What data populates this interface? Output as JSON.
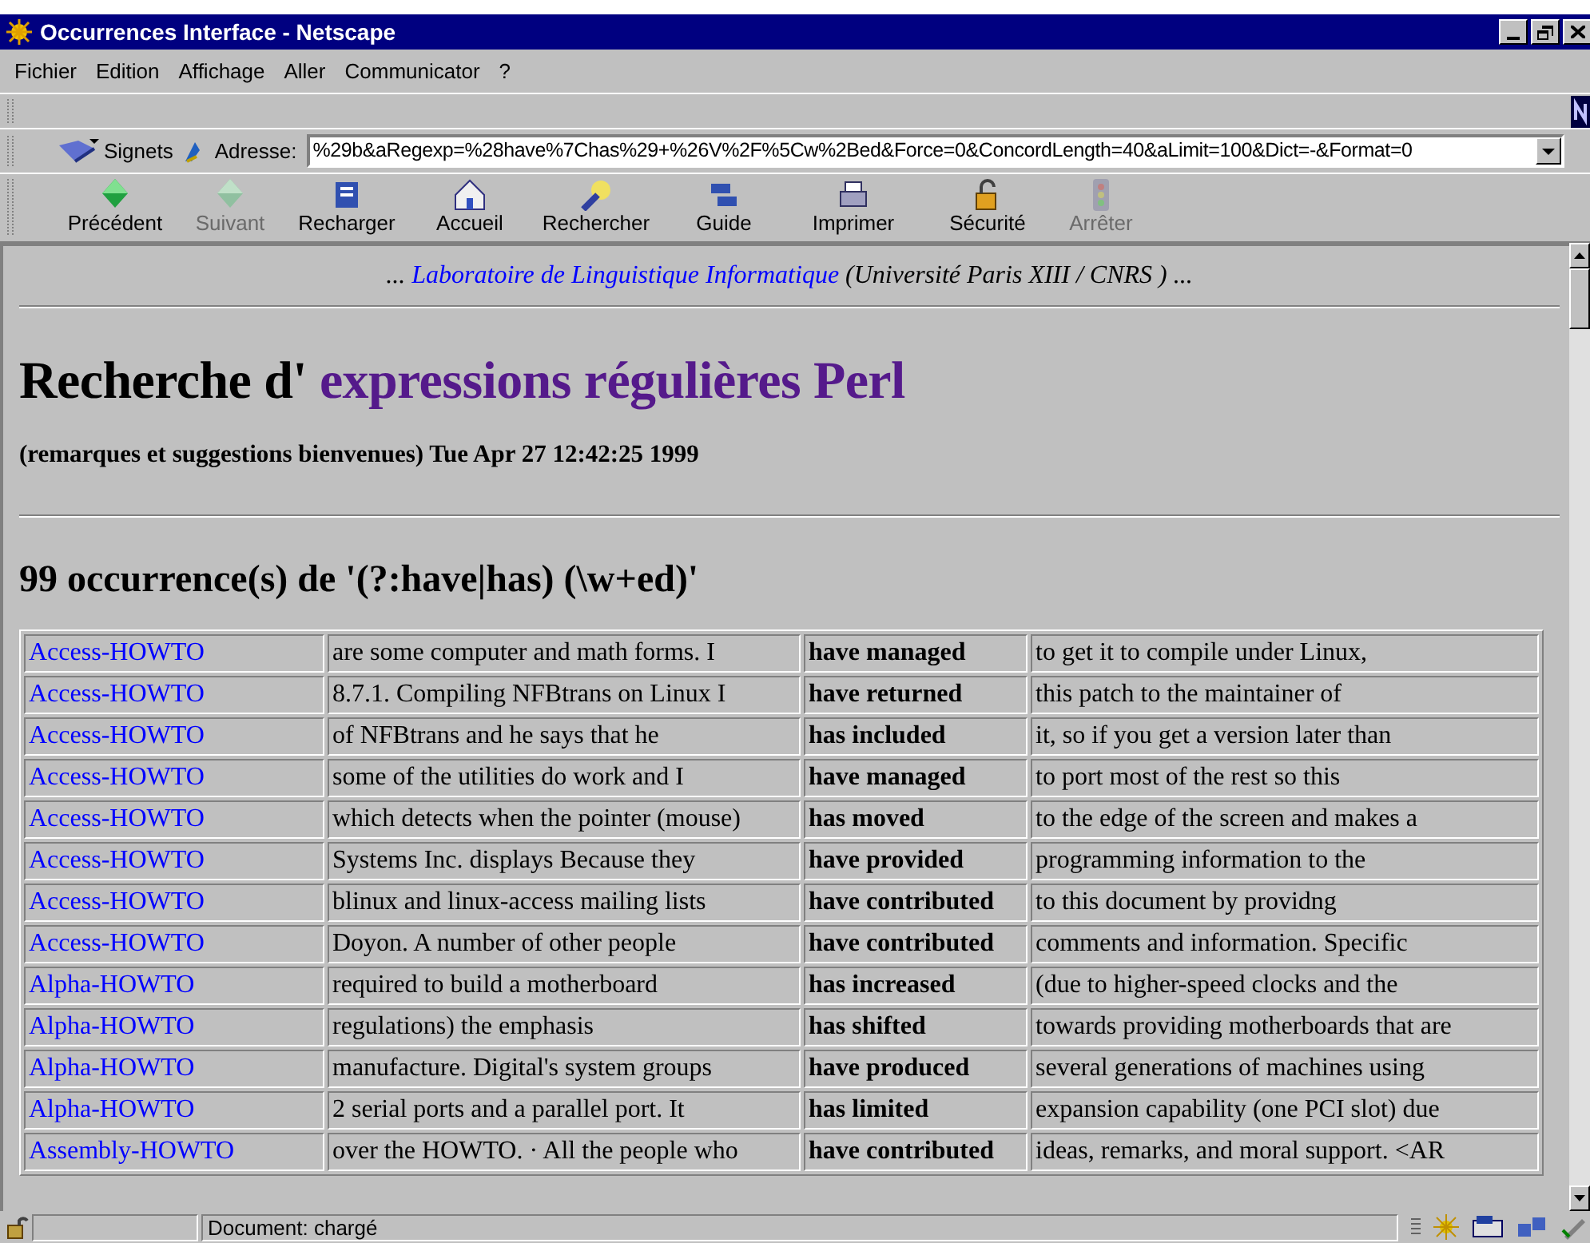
{
  "window": {
    "title": "Occurrences Interface - Netscape"
  },
  "menu": [
    "Fichier",
    "Edition",
    "Affichage",
    "Aller",
    "Communicator",
    "?"
  ],
  "location_bar": {
    "bookmarks": "Signets",
    "address_label": "Adresse:",
    "address": "%29b&aRegexp=%28have%7Chas%29+%26V%2F%5Cw%2Bed&Force=0&ConcordLength=40&aLimit=100&Dict=-&Format=0"
  },
  "toolbar": [
    {
      "label": "Précédent",
      "disabled": false
    },
    {
      "label": "Suivant",
      "disabled": true
    },
    {
      "label": "Recharger",
      "disabled": false
    },
    {
      "label": "Accueil",
      "disabled": false
    },
    {
      "label": "Rechercher",
      "disabled": false
    },
    {
      "label": "Guide",
      "disabled": false
    },
    {
      "label": "Imprimer",
      "disabled": false
    },
    {
      "label": "Sécurité",
      "disabled": false
    },
    {
      "label": "Arrêter",
      "disabled": true
    }
  ],
  "page": {
    "credit_prefix": "...",
    "credit_link": "Laboratoire de Linguistique Informatique",
    "credit_suffix": "(Université Paris XIII / CNRS ) ...",
    "heading_plain": "Recherche d'",
    "heading_link": "expressions régulières Perl",
    "subtitle": "(remarques et suggestions bienvenues) Tue Apr 27 12:42:25 1999",
    "results_heading": "99 occurrence(s) de '(?:have|has) (\\w+ed)'",
    "rows": [
      {
        "doc": "Access-HOWTO",
        "left": "are some computer and math forms. I",
        "match": "have managed",
        "right": "to get it to compile under Linux,"
      },
      {
        "doc": "Access-HOWTO",
        "left": "8.7.1. Compiling NFBtrans on Linux I",
        "match": "have returned",
        "right": "this patch to the maintainer of"
      },
      {
        "doc": "Access-HOWTO",
        "left": "of NFBtrans and he says that he",
        "match": "has included",
        "right": "it, so if you get a version later than"
      },
      {
        "doc": "Access-HOWTO",
        "left": "some of the utilities do work and I",
        "match": "have managed",
        "right": "to port most of the rest so this"
      },
      {
        "doc": "Access-HOWTO",
        "left": "which detects when the pointer (mouse)",
        "match": "has moved",
        "right": "to the edge of the screen and makes a"
      },
      {
        "doc": "Access-HOWTO",
        "left": "Systems Inc. displays Because they",
        "match": "have provided",
        "right": "programming information to the"
      },
      {
        "doc": "Access-HOWTO",
        "left": "blinux and linux-access mailing lists",
        "match": "have contributed",
        "right": "to this document by providng"
      },
      {
        "doc": "Access-HOWTO",
        "left": "Doyon. A number of other people",
        "match": "have contributed",
        "right": "comments and information. Specific"
      },
      {
        "doc": "Alpha-HOWTO",
        "left": "required to build a motherboard",
        "match": "has increased",
        "right": "(due to higher-speed clocks and the"
      },
      {
        "doc": "Alpha-HOWTO",
        "left": "regulations) the emphasis",
        "match": "has shifted",
        "right": "towards providing motherboards that are"
      },
      {
        "doc": "Alpha-HOWTO",
        "left": "manufacture. Digital's system groups",
        "match": "have produced",
        "right": "several generations of machines using"
      },
      {
        "doc": "Alpha-HOWTO",
        "left": "2 serial ports and a parallel port. It",
        "match": "has limited",
        "right": "expansion capability (one PCI slot) due"
      },
      {
        "doc": "Assembly-HOWTO",
        "left": "over the HOWTO. · All the people who",
        "match": "have contributed",
        "right": "ideas, remarks, and moral support. <AR"
      }
    ]
  },
  "status_bar": {
    "text": "Document: chargé"
  }
}
